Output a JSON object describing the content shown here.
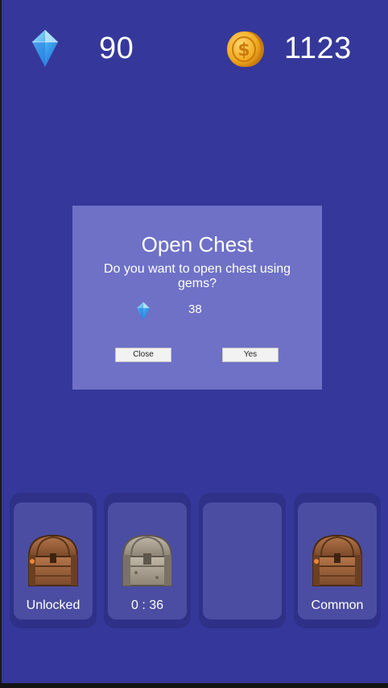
{
  "hud": {
    "gems": "90",
    "coins": "1123"
  },
  "dialog": {
    "title": "Open Chest",
    "message": "Do you want to open chest using gems?",
    "cost": "38",
    "close_label": "Close",
    "yes_label": "Yes"
  },
  "slots": [
    {
      "label": "Unlocked",
      "chest": "wooden-chest-icon"
    },
    {
      "label": "0 : 36",
      "chest": "stone-chest-icon"
    },
    {
      "label": "",
      "chest": ""
    },
    {
      "label": "Common",
      "chest": "wooden-chest-icon"
    }
  ],
  "colors": {
    "background": "#35389a",
    "dialog": "#6e71c6",
    "slot_outer": "#2e3187",
    "slot_inner": "#4b4da2",
    "gem": "#3fa8f0",
    "coin": "#f0a81e"
  }
}
